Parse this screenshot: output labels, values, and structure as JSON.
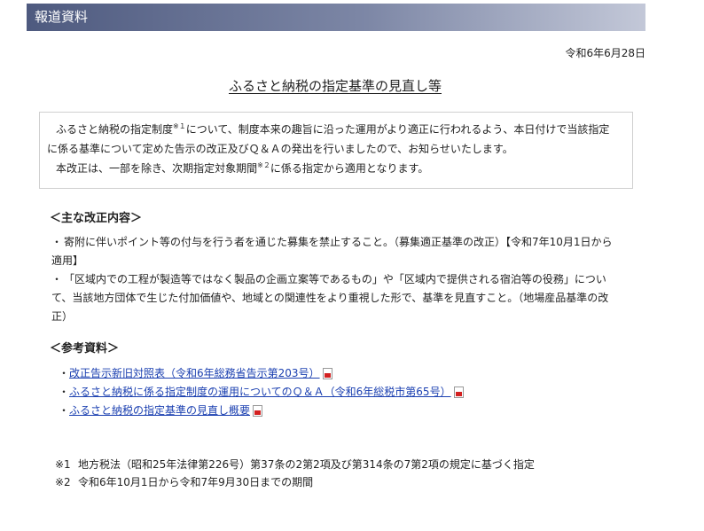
{
  "header": {
    "title": "報道資料"
  },
  "date": "令和6年6月28日",
  "title": "ふるさと納税の指定基準の見直し等",
  "intro": {
    "p1_a": "ふるさと納税の指定制度",
    "p1_sup": "※１",
    "p1_b": "について、制度本来の趣旨に沿った運用がより適正に行われるよう、本日付けで当該指定",
    "p1_line2": "に係る基準について定めた告示の改正及びＱ＆Ａの発出を行いましたので、お知らせいたします。",
    "p2_a": "本改正は、一部を除き、次期指定対象期間",
    "p2_sup": "※２",
    "p2_b": "に係る指定から適用となります。"
  },
  "main_changes": {
    "heading": "＜主な改正内容＞",
    "items": [
      {
        "mark": "・",
        "line1": "寄附に伴いポイント等の付与を行う者を通じた募集を禁止すること。（募集適正基準の改正）【令和7年10月1日から",
        "line2": "適用】"
      },
      {
        "mark": "・",
        "line1": "「区域内での工程が製造等ではなく製品の企画立案等であるもの」や「区域内で提供される宿泊等の役務」につい",
        "line2": "て、当該地方団体で生じた付加価値や、地域との関連性をより重視した形で、基準を見直すこと。（地場産品基準の改",
        "line3": "正）"
      }
    ]
  },
  "references": {
    "heading": "＜参考資料＞",
    "items": [
      {
        "mark": "・",
        "label": "改正告示新旧対照表（令和6年総務省告示第203号）",
        "icon": "pdf-icon"
      },
      {
        "mark": "・",
        "label": "ふるさと納税に係る指定制度の運用についてのＱ＆Ａ（令和6年総税市第65号）",
        "icon": "pdf-icon"
      },
      {
        "mark": "・",
        "label": "ふるさと納税の指定基準の見直し概要",
        "icon": "pdf-icon"
      }
    ]
  },
  "notes": [
    {
      "num": "※1",
      "text": "地方税法（昭和25年法律第226号）第37条の2第2項及び第314条の7第2項の規定に基づく指定"
    },
    {
      "num": "※2",
      "text": "令和6年10月1日から令和7年9月30日までの期間"
    }
  ],
  "colors": {
    "header_bar": "#4e5a7f",
    "link": "#1a3fb0",
    "pdf_icon": "#d32020"
  }
}
